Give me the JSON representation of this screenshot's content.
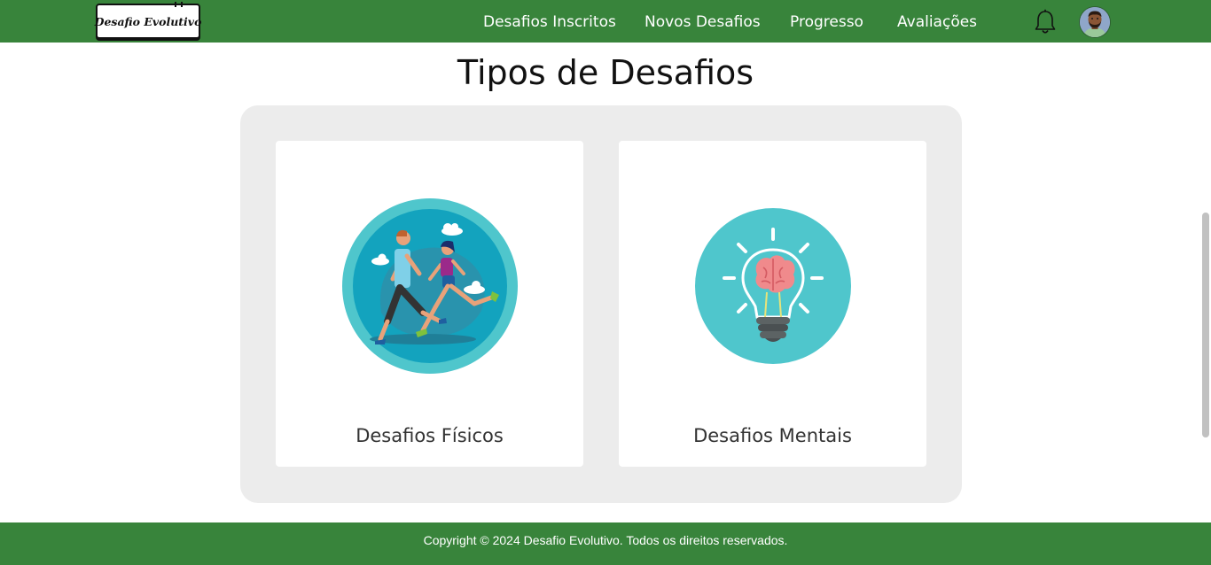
{
  "header": {
    "logo_text": "Desafio Evolutivo",
    "nav": [
      {
        "label": "Desafios Inscritos"
      },
      {
        "label": "Novos Desafios"
      },
      {
        "label": "Progresso"
      },
      {
        "label": "Avaliações"
      }
    ],
    "icons": [
      "bell-icon",
      "user-avatar"
    ]
  },
  "main": {
    "title": "Tipos de Desafios",
    "cards": [
      {
        "label": "Desafios Físicos",
        "image": "runners-illustration"
      },
      {
        "label": "Desafios Mentais",
        "image": "brain-lightbulb-illustration"
      }
    ]
  },
  "footer": {
    "text": "Copyright © 2024 Desafio Evolutivo. Todos os direitos reservados."
  },
  "colors": {
    "brand_green": "#38843b",
    "panel_gray": "#ececec",
    "card_bg": "#ffffff",
    "illustration_teal": "#4fc6cc"
  }
}
